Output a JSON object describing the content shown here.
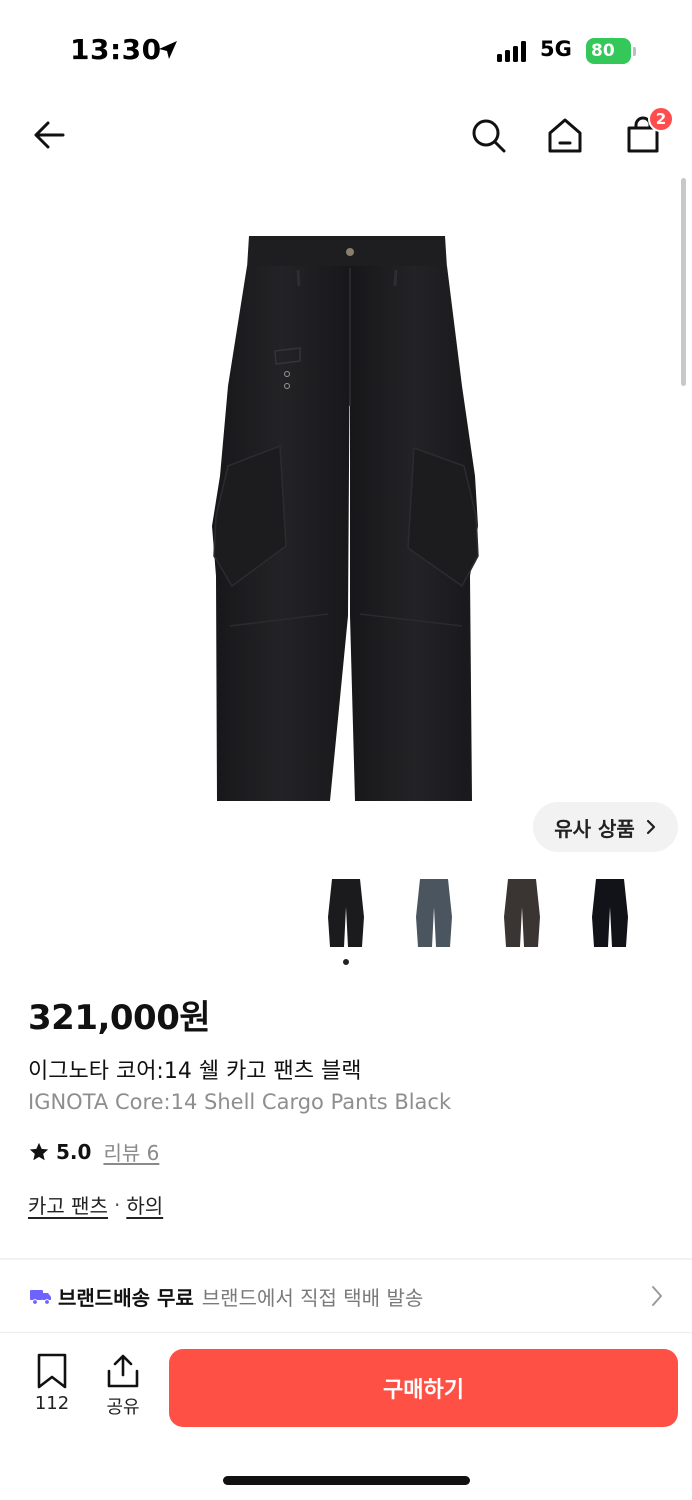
{
  "status_bar": {
    "time": "13:30",
    "network": "5G",
    "battery": "80",
    "icons": [
      "location-arrow-icon",
      "signal-icon",
      "battery-icon"
    ]
  },
  "nav": {
    "icons": [
      "back-arrow-icon",
      "search-icon",
      "home-icon",
      "shopping-bag-icon"
    ],
    "cart_count": "2"
  },
  "gallery": {
    "similar_button": "유사 상품",
    "thumbnail_colors": [
      "#1b1b1e",
      "#4a5560",
      "#3a3532",
      "#121318"
    ],
    "active_index": 0
  },
  "product": {
    "price": "321,000원",
    "title_ko": "이그노타 코어:14 쉘 카고 팬츠 블랙",
    "title_en": "IGNOTA Core:14 Shell Cargo Pants Black",
    "rating": "5.0",
    "review_label": "리뷰 6",
    "categories": [
      "카고 팬츠",
      "하의"
    ],
    "category_separator": "·"
  },
  "shipping": {
    "title": "브랜드배송 무료",
    "desc": "브랜드에서 직접 택배 발송",
    "icon": "truck-icon",
    "accent": "#6d63ff"
  },
  "bottom_bar": {
    "bookmark_count": "112",
    "share_label": "공유",
    "buy_label": "구매하기",
    "buy_color": "#ff5046"
  }
}
